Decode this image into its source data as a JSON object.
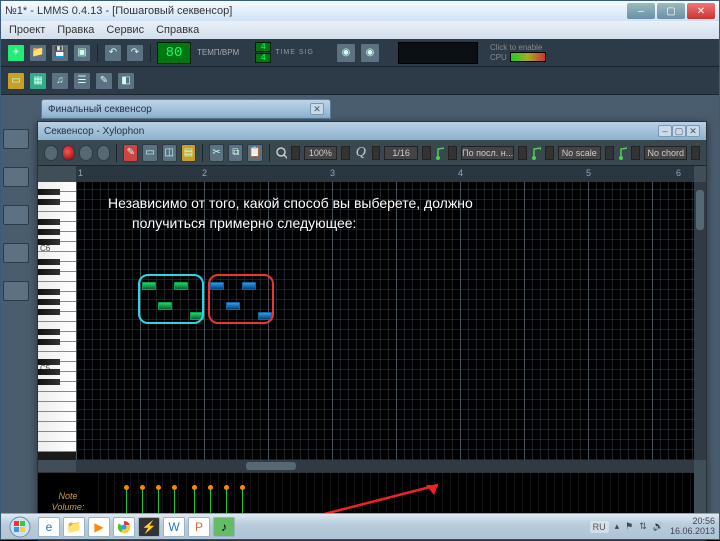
{
  "window": {
    "title": "№1* - LMMS 0.4.13 - [Пошаговый секвенсор]",
    "min": "–",
    "max": "▢",
    "close": "✕"
  },
  "menu": {
    "project": "Проект",
    "edit": "Правка",
    "tools": "Сервис",
    "help": "Справка"
  },
  "transport": {
    "tempo_value": "80",
    "tempo_label": "ТЕМП/BPM",
    "timesig_top": "4",
    "timesig_bot": "4",
    "timesig_label": "TIME SIG",
    "click_label": "Click to enable",
    "cpu_label": "CPU"
  },
  "songeditor": {
    "title": "Финальный секвенсор"
  },
  "pianoroll": {
    "title": "Секвенсор - Xylophon",
    "zoom": "100%",
    "quant": "1/16",
    "order": "По посл. н...",
    "scale": "No scale",
    "chord": "No chord",
    "ruler": [
      "1",
      "2",
      "3",
      "4",
      "5",
      "6"
    ],
    "oct_hi": "C6",
    "oct_lo": "C5",
    "vel_label": "Note\nVolume:"
  },
  "overlay": {
    "line1": "Независимо от того, какой способ вы выберете, должно",
    "line2": "получиться примерно следующее:"
  },
  "taskbar": {
    "lang": "RU",
    "time": "20:56",
    "date": "16.06.2013"
  }
}
